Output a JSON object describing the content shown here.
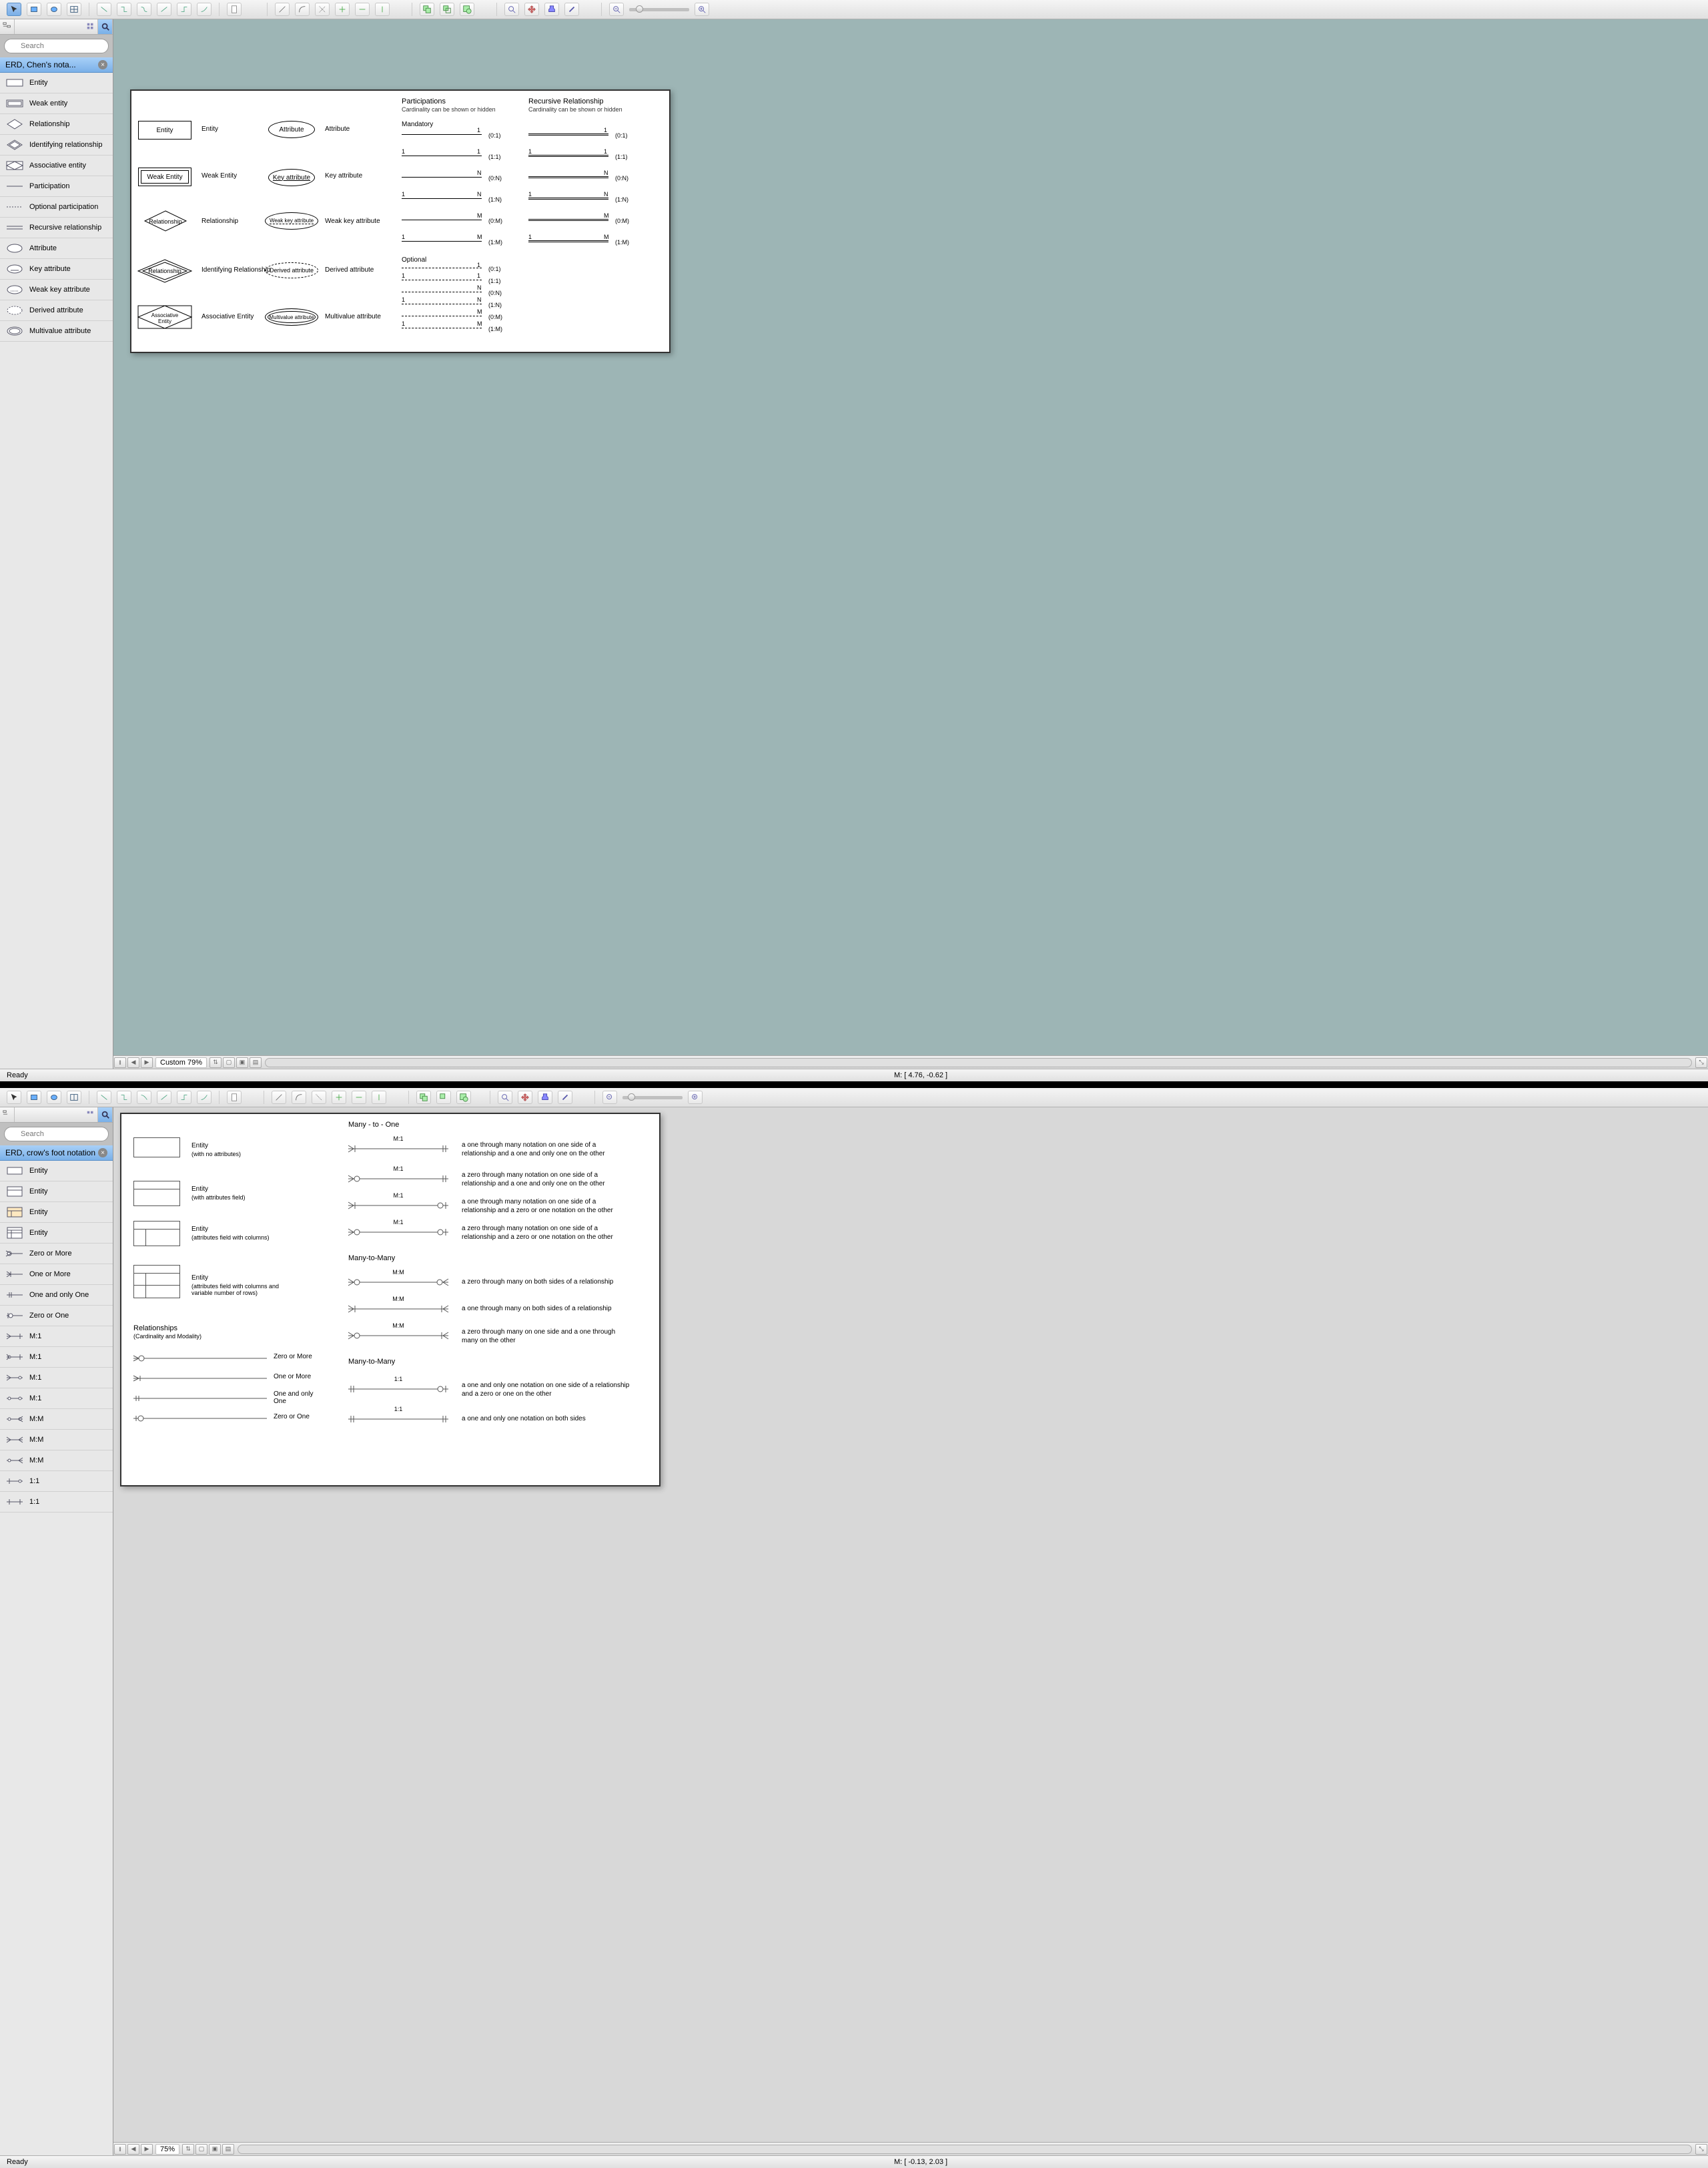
{
  "chens": {
    "search_placeholder": "Search",
    "library_name": "ERD, Chen's nota...",
    "items": [
      {
        "label": "Entity"
      },
      {
        "label": "Weak entity"
      },
      {
        "label": "Relationship"
      },
      {
        "label": "Identifying relationship"
      },
      {
        "label": "Associative entity"
      },
      {
        "label": "Participation"
      },
      {
        "label": "Optional participation"
      },
      {
        "label": "Recursive relationship"
      },
      {
        "label": "Attribute"
      },
      {
        "label": "Key attribute"
      },
      {
        "label": "Weak key attribute"
      },
      {
        "label": "Derived attribute"
      },
      {
        "label": "Multivalue attribute"
      }
    ],
    "canvas": {
      "shapes": {
        "entity": {
          "text": "Entity",
          "label": "Entity"
        },
        "weak_entity": {
          "text": "Weak Entity",
          "label": "Weak Entity"
        },
        "relationship": {
          "text": "Relationship",
          "label": "Relationship"
        },
        "identifying": {
          "text": "Relationship",
          "label": "Identifying Relationship"
        },
        "associative": {
          "text": "Associative Entity",
          "label": "Associative Entity"
        },
        "attribute": {
          "text": "Attribute",
          "label": "Attribute"
        },
        "key_attr": {
          "text": "Key attribute",
          "label": "Key attribute"
        },
        "weak_key": {
          "text": "Weak key attribute",
          "label": "Weak key attribute"
        },
        "derived": {
          "text": "Derived attribute",
          "label": "Derived attribute"
        },
        "multivalue": {
          "text": "Multivalue attribute",
          "label": "Multivalue attribute"
        }
      },
      "participations_title": "Participations",
      "participations_sub": "Cardinality can be shown or hidden",
      "recursive_title": "Recursive Relationship",
      "recursive_sub": "Cardinality can be shown or hidden",
      "mandatory_label": "Mandatory",
      "optional_label": "Optional",
      "cards": {
        "c01": "(0:1)",
        "c11": "(1:1)",
        "c0n": "(0:N)",
        "c1n": "(1:N)",
        "c0m": "(0:M)",
        "c1m": "(1:M)"
      },
      "nums": {
        "one": "1",
        "n": "N",
        "m": "M"
      }
    },
    "zoom_text": "Custom 79%",
    "status_ready": "Ready",
    "status_coords": "M: [ 4.76, -0.62 ]"
  },
  "crows": {
    "search_placeholder": "Search",
    "library_name": "ERD, crow's foot notation",
    "items": [
      {
        "label": "Entity"
      },
      {
        "label": "Entity"
      },
      {
        "label": "Entity"
      },
      {
        "label": "Entity"
      },
      {
        "label": "Zero or More"
      },
      {
        "label": "One or More"
      },
      {
        "label": "One and only One"
      },
      {
        "label": "Zero or One"
      },
      {
        "label": "M:1"
      },
      {
        "label": "M:1"
      },
      {
        "label": "M:1"
      },
      {
        "label": "M:1"
      },
      {
        "label": "M:M"
      },
      {
        "label": "M:M"
      },
      {
        "label": "M:M"
      },
      {
        "label": "1:1"
      },
      {
        "label": "1:1"
      }
    ],
    "canvas": {
      "entities": {
        "e1": {
          "title": "Entity",
          "sub": "(with no attributes)"
        },
        "e2": {
          "title": "Entity",
          "sub": "(with attributes field)"
        },
        "e3": {
          "title": "Entity",
          "sub": "(attributes field with columns)"
        },
        "e4": {
          "title": "Entity",
          "sub": "(attributes field with columns and variable number of rows)"
        }
      },
      "relationships_title": "Relationships",
      "relationships_sub": "(Cardinality and Modality)",
      "basic": {
        "zero_more": "Zero or More",
        "one_more": "One or More",
        "one_only": "One and only One",
        "zero_one": "Zero or One"
      },
      "sections": {
        "m1": "Many - to - One",
        "mm": "Many-to-Many",
        "mm2": "Many-to-Many"
      },
      "lines": {
        "m1a": {
          "label": "M:1",
          "desc": "a one through many notation on one side of a relationship and a one and only one on the other"
        },
        "m1b": {
          "label": "M:1",
          "desc": "a zero through many notation on one side of a relationship and a one and only one on the other"
        },
        "m1c": {
          "label": "M:1",
          "desc": "a one through many notation on one side of a relationship and a zero or one notation on the other"
        },
        "m1d": {
          "label": "M:1",
          "desc": "a zero through many notation on one side of a relationship and a zero or one notation on the other"
        },
        "mma": {
          "label": "M:M",
          "desc": "a zero through many on both sides of a relationship"
        },
        "mmb": {
          "label": "M:M",
          "desc": "a one through many on both sides of a relationship"
        },
        "mmc": {
          "label": "M:M",
          "desc": "a zero through many on one side and a one through many on the other"
        },
        "o1a": {
          "label": "1:1",
          "desc": "a one and only one notation on one side of a relationship and a zero or one on the other"
        },
        "o1b": {
          "label": "1:1",
          "desc": "a one and only one notation on both sides"
        }
      }
    },
    "zoom_text": "75%",
    "status_ready": "Ready",
    "status_coords": "M: [ -0.13, 2.03 ]"
  }
}
